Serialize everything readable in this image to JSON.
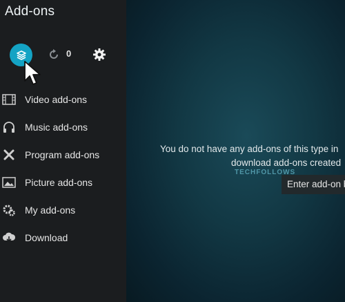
{
  "header": {
    "title": "Add-ons"
  },
  "toolbar": {
    "addon_browser_icon": "open-box-icon",
    "refresh_icon": "refresh-icon",
    "update_count": "0",
    "settings_icon": "gear-icon",
    "accent": "#14a3c4"
  },
  "sidebar": {
    "items": [
      {
        "label": "Video add-ons",
        "icon": "film-icon"
      },
      {
        "label": "Music add-ons",
        "icon": "headphones-icon"
      },
      {
        "label": "Program add-ons",
        "icon": "tools-icon"
      },
      {
        "label": "Picture add-ons",
        "icon": "picture-icon"
      },
      {
        "label": "My add-ons",
        "icon": "cog-box-icon"
      },
      {
        "label": "Download",
        "icon": "cloud-download-icon"
      }
    ]
  },
  "main": {
    "empty_line1": "You do not have any add-ons of this type in",
    "empty_line2": "download add-ons created",
    "watermark": "TECHFOLLOWS",
    "enter_button": "Enter add-on b"
  }
}
